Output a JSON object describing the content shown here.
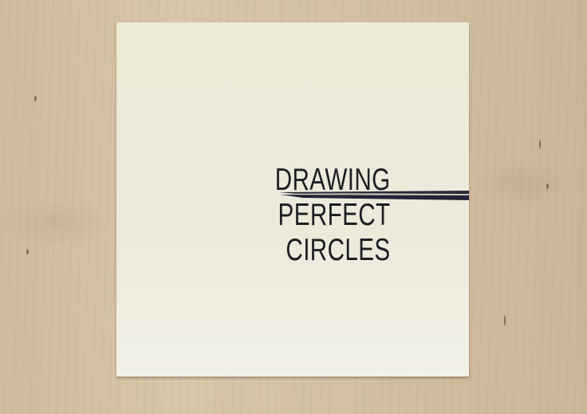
{
  "card": {
    "title_lines": [
      "DRAWING",
      "PERFECT",
      "CIRCLES"
    ]
  },
  "colors": {
    "wood": "#d6c3a5",
    "card": "#ecead6",
    "text": "#1e1e22"
  }
}
